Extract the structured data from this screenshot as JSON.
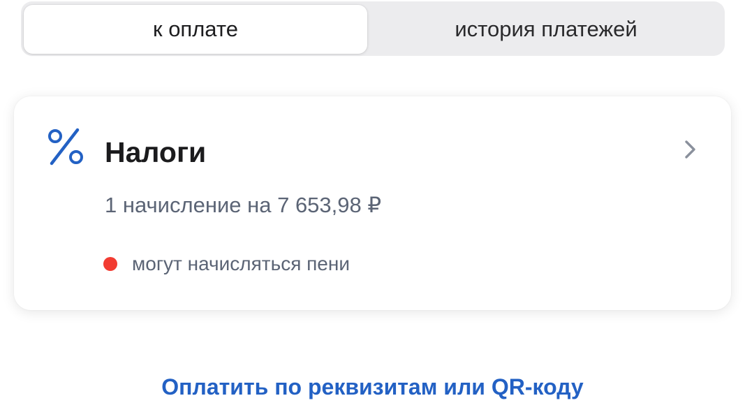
{
  "tabs": {
    "active_label": "к оплате",
    "inactive_label": "история платежей"
  },
  "card": {
    "icon": "percent-icon",
    "title": "Налоги",
    "subtitle": "1 начисление на 7 653,98 ₽",
    "status_text": "могут начисляться пени",
    "status_color": "#f23c32",
    "chevron": "chevron-right-icon"
  },
  "link": {
    "label": "Оплатить по реквизитам или QR-коду",
    "color": "#2361c4"
  },
  "colors": {
    "accent": "#2361c4",
    "secondary_text": "#5b6475"
  }
}
